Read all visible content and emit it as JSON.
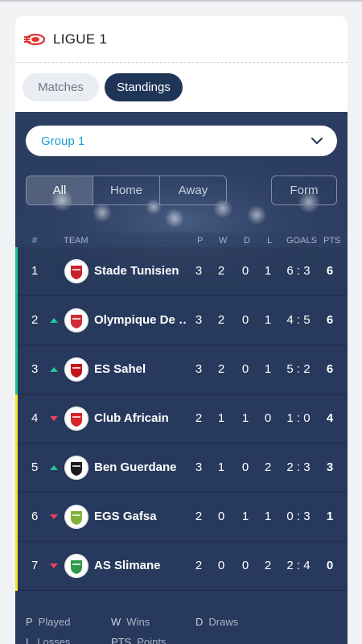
{
  "header": {
    "logo_icon": "league-logo-icon",
    "title": "LIGUE 1"
  },
  "nav_tabs": [
    {
      "label": "Matches",
      "active": false
    },
    {
      "label": "Standings",
      "active": true
    }
  ],
  "group_select": {
    "value": "Group 1",
    "icon": "chevron-down-icon"
  },
  "venue_filter": {
    "options": [
      "All",
      "Home",
      "Away"
    ],
    "selected": "All"
  },
  "form_button": "Form",
  "table_headers": {
    "rank": "#",
    "team": "TEAM",
    "played": "P",
    "wins": "W",
    "draws": "D",
    "losses": "L",
    "goals": "GOALS",
    "points": "PTS"
  },
  "standings": [
    {
      "rank": "1",
      "trend": "none",
      "team": "Stade Tunisien",
      "played": "3",
      "wins": "2",
      "draws": "0",
      "losses": "1",
      "goals": "6 : 3",
      "points": "6",
      "qualification": "#1ec391"
    },
    {
      "rank": "2",
      "trend": "up",
      "team": "Olympique De …",
      "played": "3",
      "wins": "2",
      "draws": "0",
      "losses": "1",
      "goals": "4 : 5",
      "points": "6",
      "qualification": "#1ec391"
    },
    {
      "rank": "3",
      "trend": "up",
      "team": "ES Sahel",
      "played": "3",
      "wins": "2",
      "draws": "0",
      "losses": "1",
      "goals": "5 : 2",
      "points": "6",
      "qualification": "#1ec391"
    },
    {
      "rank": "4",
      "trend": "down",
      "team": "Club Africain",
      "played": "2",
      "wins": "1",
      "draws": "1",
      "losses": "0",
      "goals": "1 : 0",
      "points": "4",
      "qualification": "#f2e52a"
    },
    {
      "rank": "5",
      "trend": "up",
      "team": "Ben Guerdane",
      "played": "3",
      "wins": "1",
      "draws": "0",
      "losses": "2",
      "goals": "2 : 3",
      "points": "3",
      "qualification": "#f2e52a"
    },
    {
      "rank": "6",
      "trend": "down",
      "team": "EGS Gafsa",
      "played": "2",
      "wins": "0",
      "draws": "1",
      "losses": "1",
      "goals": "0 : 3",
      "points": "1",
      "qualification": "#f2e52a"
    },
    {
      "rank": "7",
      "trend": "down",
      "team": "AS Slimane",
      "played": "2",
      "wins": "0",
      "draws": "0",
      "losses": "2",
      "goals": "2 : 4",
      "points": "0",
      "qualification": "#f2e52a"
    }
  ],
  "legend": [
    {
      "key": "P",
      "label": "Played"
    },
    {
      "key": "W",
      "label": "Wins"
    },
    {
      "key": "D",
      "label": "Draws"
    },
    {
      "key": "L",
      "label": "Losses"
    },
    {
      "key": "PTS",
      "label": "Points"
    }
  ],
  "colors": {
    "accent_navy": "#1f3557",
    "panel": "#27395c",
    "select_text": "#1aa0d8",
    "trend_up": "#27c49a",
    "trend_down": "#e8455a"
  }
}
